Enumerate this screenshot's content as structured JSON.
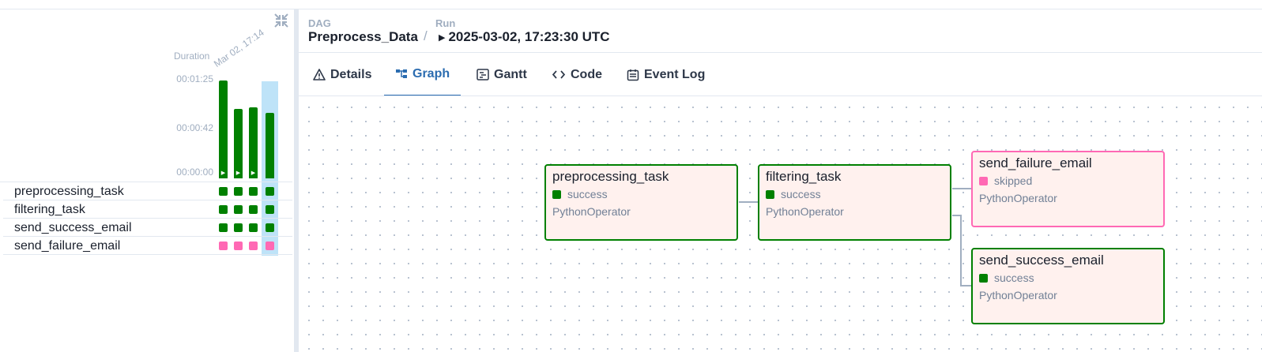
{
  "grid": {
    "duration_label": "Duration",
    "run_date": "Mar 02, 17:14",
    "ticks": [
      "00:01:25",
      "00:00:42",
      "00:00:00"
    ],
    "durations_sec": [
      85,
      60,
      62,
      57
    ],
    "tasks": [
      {
        "name": "preprocessing_task",
        "states": [
          "success",
          "success",
          "success",
          "success"
        ]
      },
      {
        "name": "filtering_task",
        "states": [
          "success",
          "success",
          "success",
          "success"
        ]
      },
      {
        "name": "send_success_email",
        "states": [
          "success",
          "success",
          "success",
          "success"
        ]
      },
      {
        "name": "send_failure_email",
        "states": [
          "skipped",
          "skipped",
          "skipped",
          "skipped"
        ]
      }
    ]
  },
  "breadcrumb": {
    "dag_label": "DAG",
    "dag_value": "Preprocess_Data",
    "separator": "/",
    "run_label": "Run",
    "run_value": "2025-03-02, 17:23:30 UTC"
  },
  "tabs": [
    {
      "label": "Details",
      "icon": "warning-icon"
    },
    {
      "label": "Graph",
      "icon": "graph-icon"
    },
    {
      "label": "Gantt",
      "icon": "gantt-icon"
    },
    {
      "label": "Code",
      "icon": "code-icon"
    },
    {
      "label": "Event Log",
      "icon": "calendar-icon"
    }
  ],
  "active_tab": "Graph",
  "graph": {
    "nodes": [
      {
        "name": "preprocessing_task",
        "state": "success",
        "operator": "PythonOperator"
      },
      {
        "name": "filtering_task",
        "state": "success",
        "operator": "PythonOperator"
      },
      {
        "name": "send_failure_email",
        "state": "skipped",
        "operator": "PythonOperator"
      },
      {
        "name": "send_success_email",
        "state": "success",
        "operator": "PythonOperator"
      }
    ]
  },
  "colors": {
    "success": "#008000",
    "skipped": "#ff69b4",
    "accent": "#2b6cb0",
    "node_bg": "#fff1ee",
    "highlight": "#bee3f8"
  }
}
